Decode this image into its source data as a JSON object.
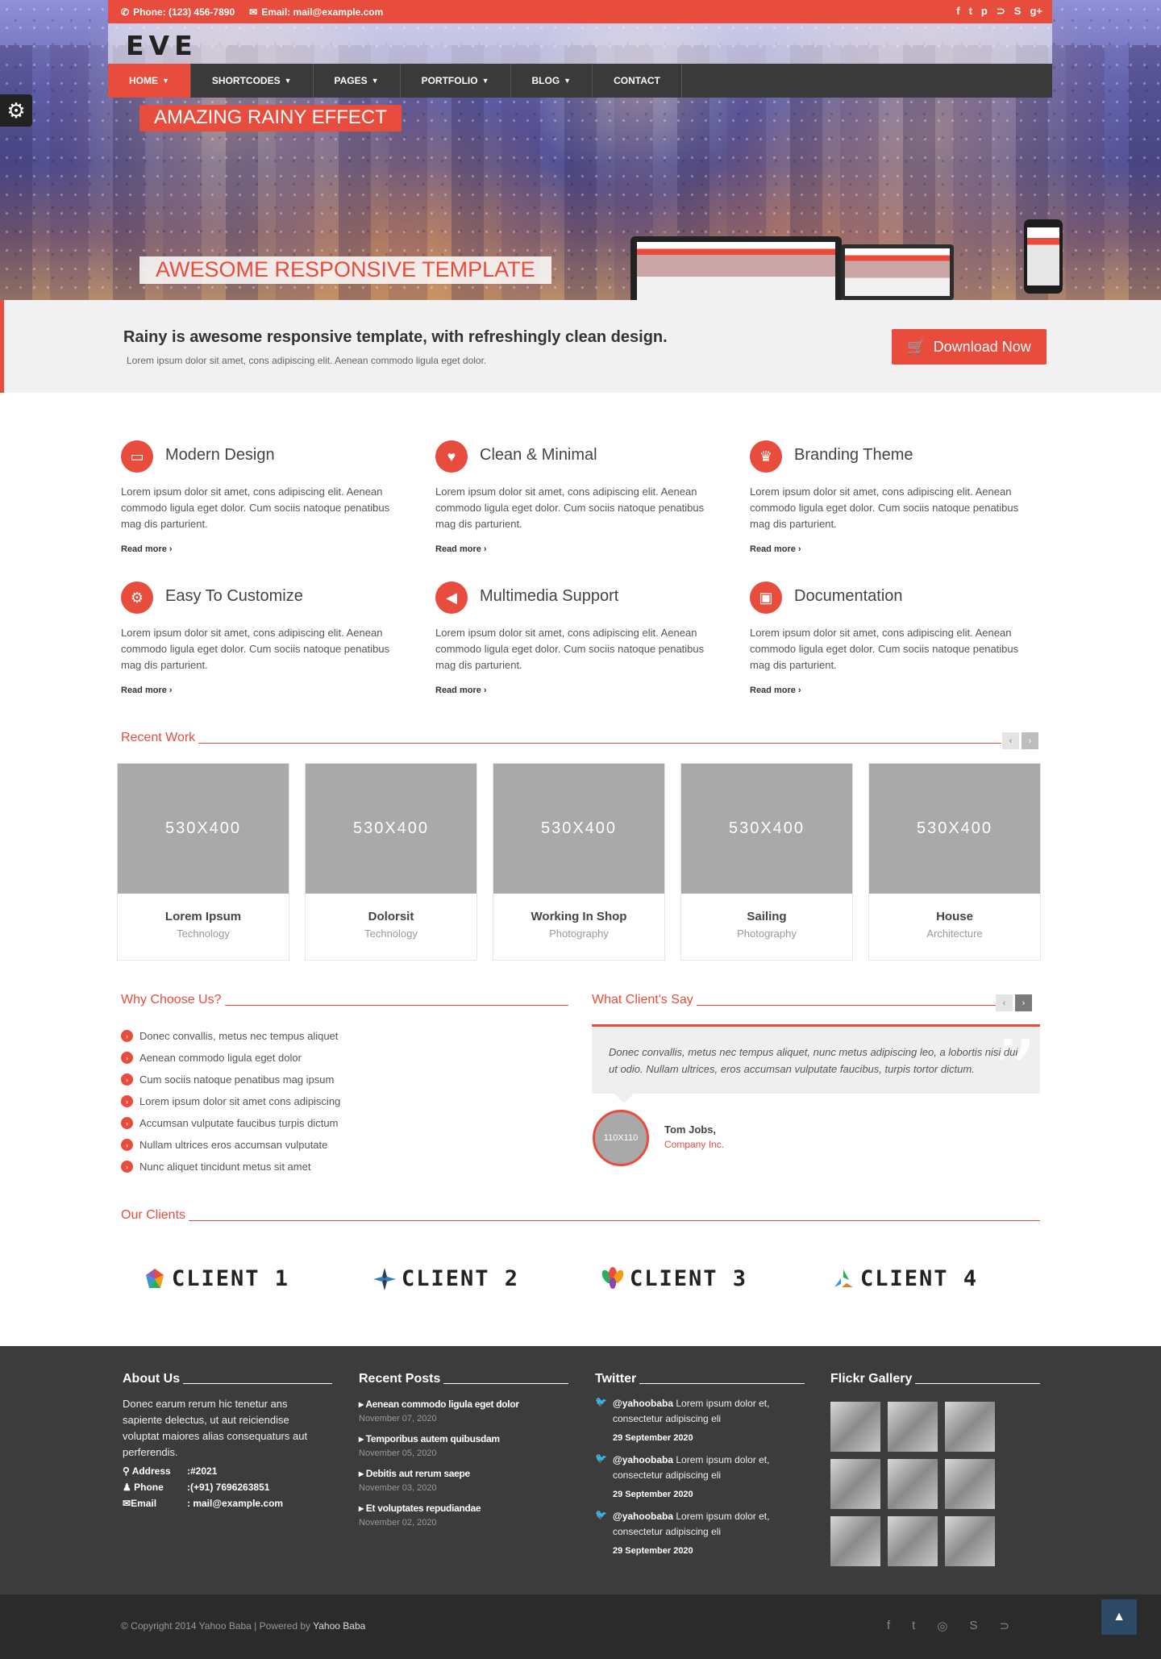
{
  "topbar": {
    "phone": "Phone: (123) 456-7890",
    "email": "Email: mail@example.com",
    "social": [
      "f",
      "t",
      "p",
      "rss",
      "s",
      "g+"
    ]
  },
  "logo": "EVE",
  "nav": {
    "items": [
      {
        "label": "HOME",
        "active": true,
        "caret": true
      },
      {
        "label": "SHORTCODES",
        "active": false,
        "caret": true
      },
      {
        "label": "PAGES",
        "active": false,
        "caret": true
      },
      {
        "label": "PORTFOLIO",
        "active": false,
        "caret": true
      },
      {
        "label": "BLOG",
        "active": false,
        "caret": true
      },
      {
        "label": "CONTACT",
        "active": false,
        "caret": false
      }
    ]
  },
  "slider": {
    "title": "AMAZING RAINY EFFECT",
    "subtitle": "AWESOME RESPONSIVE TEMPLATE"
  },
  "callout": {
    "heading": "Rainy is awesome responsive template, with refreshingly clean design.",
    "text": "Lorem ipsum dolor sit amet, cons adipiscing elit. Aenean commodo ligula eget dolor.",
    "button": "Download Now"
  },
  "features": [
    {
      "title": "Modern Design",
      "icon": "laptop-icon",
      "glyph": "▭",
      "text": "Lorem ipsum dolor sit amet, cons adipiscing elit. Aenean commodo ligula eget dolor. Cum sociis natoque penatibus mag dis parturient.",
      "more": "Read more"
    },
    {
      "title": "Clean & Minimal",
      "icon": "heart-icon",
      "glyph": "♥",
      "text": "Lorem ipsum dolor sit amet, cons adipiscing elit. Aenean commodo ligula eget dolor. Cum sociis natoque penatibus mag dis parturient.",
      "more": "Read more"
    },
    {
      "title": "Branding Theme",
      "icon": "trophy-icon",
      "glyph": "♛",
      "text": "Lorem ipsum dolor sit amet, cons adipiscing elit. Aenean commodo ligula eget dolor. Cum sociis natoque penatibus mag dis parturient.",
      "more": "Read more"
    },
    {
      "title": "Easy To Customize",
      "icon": "gear-icon",
      "glyph": "⚙",
      "text": "Lorem ipsum dolor sit amet, cons adipiscing elit. Aenean commodo ligula eget dolor. Cum sociis natoque penatibus mag dis parturient.",
      "more": "Read more"
    },
    {
      "title": "Multimedia Support",
      "icon": "speaker-icon",
      "glyph": "◀",
      "text": "Lorem ipsum dolor sit amet, cons adipiscing elit. Aenean commodo ligula eget dolor. Cum sociis natoque penatibus mag dis parturient.",
      "more": "Read more"
    },
    {
      "title": "Documentation",
      "icon": "briefcase-icon",
      "glyph": "▣",
      "text": "Lorem ipsum dolor sit amet, cons adipiscing elit. Aenean commodo ligula eget dolor. Cum sociis natoque penatibus mag dis parturient.",
      "more": "Read more"
    }
  ],
  "recent_work": {
    "title": "Recent Work",
    "items": [
      {
        "thumb": "530X400",
        "name": "Lorem Ipsum",
        "category": "Technology"
      },
      {
        "thumb": "530X400",
        "name": "Dolorsit",
        "category": "Technology"
      },
      {
        "thumb": "530X400",
        "name": "Working In Shop",
        "category": "Photography"
      },
      {
        "thumb": "530X400",
        "name": "Sailing",
        "category": "Photography"
      },
      {
        "thumb": "530X400",
        "name": "House",
        "category": "Architecture"
      }
    ]
  },
  "why": {
    "title": "Why Choose Us?",
    "items": [
      "Donec convallis, metus nec tempus aliquet",
      "Aenean commodo ligula eget dolor",
      "Cum sociis natoque penatibus mag ipsum",
      "Lorem ipsum dolor sit amet cons adipiscing",
      "Accumsan vulputate faucibus turpis dictum",
      "Nullam ultrices eros accumsan vulputate",
      "Nunc aliquet tincidunt metus sit amet"
    ]
  },
  "testimonial": {
    "title": "What Client's Say",
    "quote": "Donec convallis, metus nec tempus aliquet, nunc metus adipiscing leo, a lobortis nisi dui ut odio. Nullam ultrices, eros accumsan vulputate faucibus, turpis tortor dictum.",
    "avatar": "110X110",
    "name": "Tom Jobs,",
    "company": "Company Inc."
  },
  "clients": {
    "title": "Our Clients",
    "items": [
      "CLIENT 1",
      "CLIENT 2",
      "CLIENT 3",
      "CLIENT 4"
    ]
  },
  "footer": {
    "about": {
      "title": "About Us",
      "text": "Donec earum rerum hic tenetur ans sapiente delectus, ut aut reiciendise voluptat maiores alias consequaturs aut perferendis.",
      "address_label": "Address",
      "address": ":#2021",
      "phone_label": "Phone",
      "phone": ":(+91) 7696263851",
      "email_label": "Email",
      "email": ": mail@example.com"
    },
    "posts": {
      "title": "Recent Posts",
      "items": [
        {
          "title": "Aenean commodo ligula eget dolor",
          "date": "November 07, 2020"
        },
        {
          "title": "Temporibus autem quibusdam",
          "date": "November 05, 2020"
        },
        {
          "title": "Debitis aut rerum saepe",
          "date": "November 03, 2020"
        },
        {
          "title": "Et voluptates repudiandae",
          "date": "November 02, 2020"
        }
      ]
    },
    "twitter": {
      "title": "Twitter",
      "items": [
        {
          "handle": "@yahoobaba",
          "text": " Lorem ipsum dolor et, consectetur adipiscing eli",
          "date": "29 September 2020"
        },
        {
          "handle": "@yahoobaba",
          "text": " Lorem ipsum dolor et, consectetur adipiscing eli",
          "date": "29 September 2020"
        },
        {
          "handle": "@yahoobaba",
          "text": " Lorem ipsum dolor et, consectetur adipiscing eli",
          "date": "29 September 2020"
        }
      ]
    },
    "flickr": {
      "title": "Flickr Gallery"
    }
  },
  "bottom": {
    "copyright": "© Copyright 2014 Yahoo Baba | Powered by ",
    "powered": "Yahoo Baba"
  },
  "colors": {
    "accent": "#e74c3c",
    "footer": "#3c3c3c",
    "bottombar": "#2b2b2b"
  }
}
